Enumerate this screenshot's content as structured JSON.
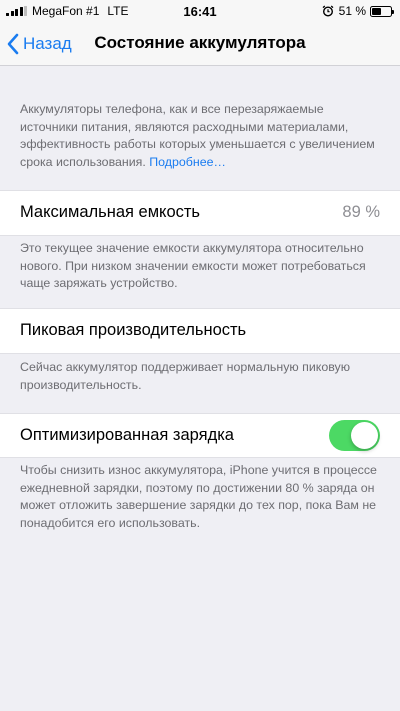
{
  "status_bar": {
    "carrier": "MegaFon #1",
    "network": "LTE",
    "time": "16:41",
    "battery_percent": "51 %",
    "battery_level": 0.51,
    "signal_bars_filled": 4,
    "signal_bars_total": 5,
    "icons": [
      "signal-icon",
      "alarm-icon",
      "battery-icon"
    ]
  },
  "nav": {
    "back_label": "Назад",
    "title": "Состояние аккумулятора",
    "accent_color": "#1a7cf0"
  },
  "intro": {
    "text": "Аккумуляторы телефона, как и все перезаряжаемые источники питания, являются расходными материалами, эффективность работы которых уменьшается с увеличением срока использования. ",
    "link": "Подробнее…"
  },
  "max_capacity": {
    "label": "Максимальная емкость",
    "value": "89 %",
    "footer": "Это текущее значение емкости аккумулятора относительно нового. При низком значении емкости может потребоваться чаще заряжать устройство."
  },
  "peak_performance": {
    "label": "Пиковая производительность",
    "footer": "Сейчас аккумулятор поддерживает нормальную пиковую производительность."
  },
  "optimized_charging": {
    "label": "Оптимизированная зарядка",
    "enabled": true,
    "toggle_color": "#4cd964",
    "footer": "Чтобы снизить износ аккумулятора, iPhone учится в процессе ежедневной зарядки, поэтому по достижении 80 % заряда он может отложить завершение зарядки до тех пор, пока Вам не понадобится его использовать."
  }
}
